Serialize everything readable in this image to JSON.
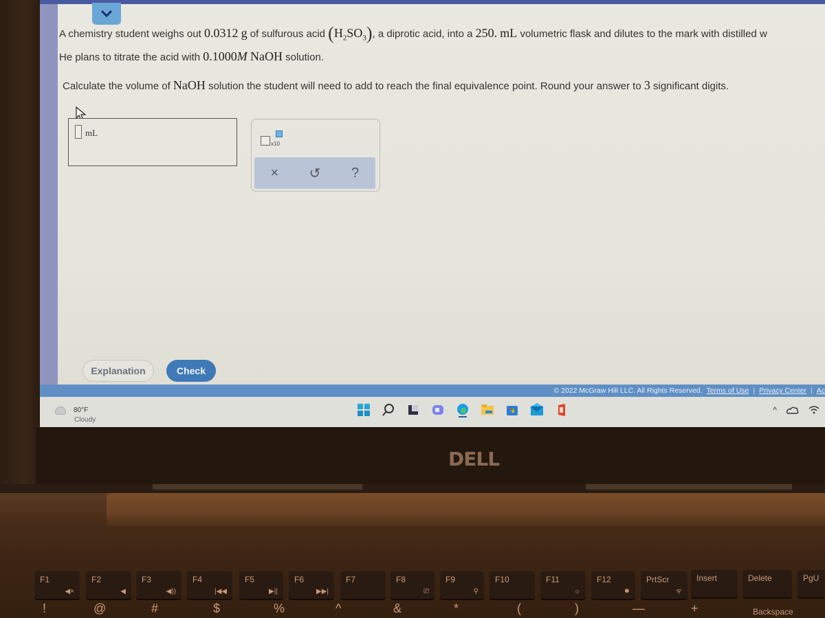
{
  "question": {
    "line1": {
      "t1": "A chemistry student weighs out ",
      "mass": "0.0312",
      "mass_unit": "g",
      "t2": " of sulfurous acid ",
      "formula_H": "H",
      "formula_H_sub": "2",
      "formula_SO": "SO",
      "formula_SO_sub": "3",
      "t3": ", a diprotic acid, into a ",
      "volume": "250.",
      "volume_unit": "mL",
      "t4": " volumetric flask and dilutes to the mark with distilled w"
    },
    "line2": {
      "t1": "He plans to titrate the acid with ",
      "molarity": "0.1000",
      "molarity_unit": "M",
      "reagent": "NaOH",
      "t2": " solution."
    },
    "line3": {
      "t1": "Calculate the volume of ",
      "reagent": "NaOH",
      "t2": " solution the student will need to add to reach the final equivalence point. Round your answer to ",
      "sig": "3",
      "t3": " significant digits."
    }
  },
  "answer": {
    "value": "",
    "unit": "mL"
  },
  "tools": {
    "x10_label": "x10",
    "clear": "×",
    "undo": "↺",
    "help": "?"
  },
  "buttons": {
    "explanation": "Explanation",
    "check": "Check"
  },
  "footer": {
    "copyright": "© 2022 McGraw Hill LLC. All Rights Reserved.",
    "terms": "Terms of Use",
    "privacy": "Privacy Center",
    "accessibility": "Ac",
    "separator": "|"
  },
  "taskbar": {
    "weather_temp": "80°F",
    "weather_condition": "Cloudy",
    "apps": [
      "start",
      "search",
      "widgets",
      "teams",
      "edge",
      "file-explorer",
      "store",
      "mail",
      "office"
    ]
  },
  "laptop": {
    "brand": "DELL",
    "fkeys": [
      {
        "label": "F1",
        "sub": "◀×"
      },
      {
        "label": "F2",
        "sub": "◀"
      },
      {
        "label": "F3",
        "sub": "◀))"
      },
      {
        "label": "F4",
        "sub": "|◀◀"
      },
      {
        "label": "F5",
        "sub": "▶||"
      },
      {
        "label": "F6",
        "sub": "▶▶|"
      },
      {
        "label": "F7",
        "sub": ""
      },
      {
        "label": "F8",
        "sub": "⎚"
      },
      {
        "label": "F9",
        "sub": "⚲"
      },
      {
        "label": "F10",
        "sub": ""
      },
      {
        "label": "F11",
        "sub": "☼"
      },
      {
        "label": "F12",
        "sub": "✹"
      },
      {
        "label": "PrtScr",
        "sub": "ᯤ"
      },
      {
        "label": "Insert",
        "sub": ""
      },
      {
        "label": "Delete",
        "sub": ""
      },
      {
        "label": "PgU",
        "sub": ""
      }
    ],
    "number_row": [
      "!",
      "@",
      "#",
      "$",
      "%",
      "^",
      "&",
      "*",
      "(",
      ")",
      "—",
      "+",
      "Backspace"
    ]
  }
}
